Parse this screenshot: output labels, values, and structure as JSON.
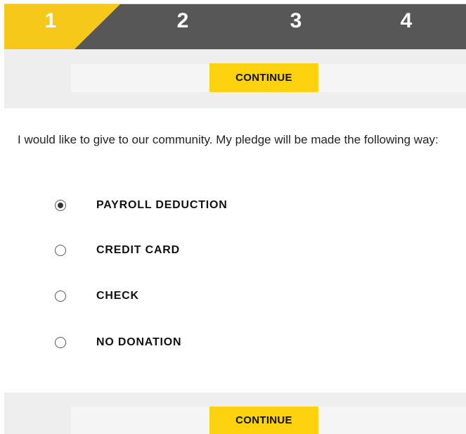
{
  "steps": {
    "items": [
      "1",
      "2",
      "3",
      "4"
    ],
    "active_index": 0
  },
  "colors": {
    "accent": "#F6C819",
    "steps_bg": "#575757",
    "button": "#FFD20F",
    "band": "#EEEEEE"
  },
  "continue_label": "CONTINUE",
  "intro_text": "I would like to give to our community. My pledge will be made the following way:",
  "pledge_options": [
    {
      "label": "PAYROLL DEDUCTION",
      "selected": true
    },
    {
      "label": "CREDIT CARD",
      "selected": false
    },
    {
      "label": "CHECK",
      "selected": false
    },
    {
      "label": "NO DONATION",
      "selected": false
    }
  ]
}
